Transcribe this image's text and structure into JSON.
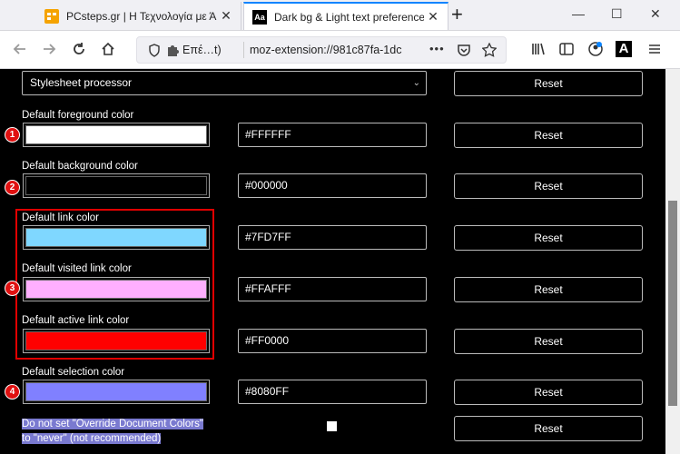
{
  "browser": {
    "tabs": [
      {
        "title": "PCsteps.gr | Η Τεχνολογία με Ά",
        "close": "✕"
      },
      {
        "favicon_text": "Aa",
        "title": "Dark bg & Light text preference",
        "close": "✕"
      }
    ],
    "new_tab": "+",
    "window": {
      "minimize": "—",
      "maximize": "☐",
      "close": "✕"
    },
    "nav": {
      "extension_label": "Επέ…t)",
      "url": "moz-extension://981c87fa-1dc",
      "more": "•••"
    }
  },
  "settings": {
    "top_clip": "",
    "stylesheet": {
      "value": "Stylesheet processor",
      "reset": "Reset"
    },
    "rows": [
      {
        "label": "Default foreground color",
        "color": "#FFFFFF",
        "hex": "#FFFFFF",
        "reset": "Reset",
        "badge": "1"
      },
      {
        "label": "Default background color",
        "color": "#000000",
        "hex": "#000000",
        "reset": "Reset",
        "badge": "2"
      },
      {
        "label": "Default link color",
        "color": "#7FD7FF",
        "hex": "#7FD7FF",
        "reset": "Reset"
      },
      {
        "label": "Default visited link color",
        "color": "#FFAFFF",
        "hex": "#FFAFFF",
        "reset": "Reset",
        "badge": "3"
      },
      {
        "label": "Default active link color",
        "color": "#FF0000",
        "hex": "#FF0000",
        "reset": "Reset"
      },
      {
        "label": "Default selection color",
        "color": "#8080FF",
        "hex": "#8080FF",
        "reset": "Reset",
        "badge": "4"
      }
    ],
    "override": {
      "line1": "Do not set \"Override Document Colors\"",
      "line2": "to \"never\" (not recommended)",
      "reset": "Reset"
    }
  }
}
